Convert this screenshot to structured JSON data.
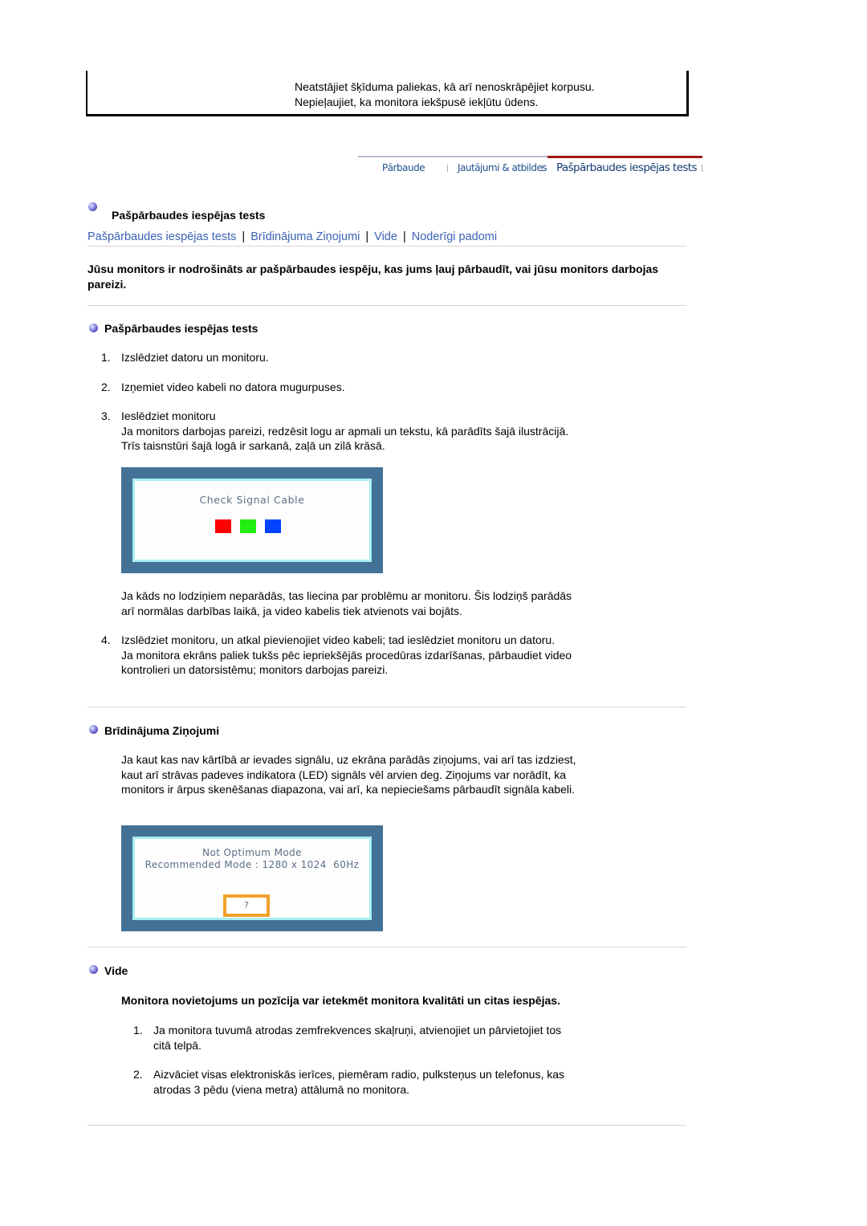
{
  "top_note": {
    "lines": [
      "Neatstājiet šķīduma paliekas, kā arī nenoskrāpējiet korpusu.",
      "Nepieļaujiet, ka monitora iekšpusē iekļūtu ūdens."
    ]
  },
  "tabs": [
    {
      "label": "Pārbaude",
      "active": false
    },
    {
      "label": "Jautājumi & atbildes",
      "active": false
    },
    {
      "label": "Pašpārbaudes iespējas tests",
      "active": true
    }
  ],
  "colors": {
    "link": "#3a62b5",
    "tab_active_line": "#a01818",
    "osd_frame": "#437296",
    "osd_highlight": "#a8eef2",
    "square_red": "#ff0000",
    "square_green": "#22ee11",
    "square_blue": "#0044ff",
    "question_border": "#f0a12a"
  },
  "page_title": "Pašpārbaudes iespējas tests",
  "nav_links": [
    "Pašpārbaudes iespējas tests",
    "Brīdinājuma Ziņojumi",
    "Vide",
    "Noderīgi padomi"
  ],
  "intro": "Jūsu monitors ir nodrošināts ar pašpārbaudes iespēju, kas jums ļauj pārbaudīt, vai jūsu monitors darbojas pareizi.",
  "self_test": {
    "heading": "Pašpārbaudes iespējas tests",
    "steps": [
      {
        "num": "1.",
        "text": "Izslēdziet datoru un monitoru."
      },
      {
        "num": "2.",
        "text": "Izņemiet video kabeli no datora mugurpuses."
      },
      {
        "num": "3.",
        "text": "Ieslēdziet monitoru",
        "detail": [
          "Ja monitors darbojas pareizi, redzēsit logu ar apmali un tekstu, kā parādīts šajā ilustrācijā.",
          "Trīs taisnstūri šajā logā ir sarkanā, zaļā un zilā krāsā."
        ]
      },
      {
        "num": "4.",
        "text": "Izslēdziet monitoru, un atkal pievienojiet video kabeli; tad ieslēdziet monitoru un datoru.",
        "detail": [
          "Ja monitora ekrāns paliek tukšs pēc iepriekšējās procedūras izdarīšanas, pārbaudiet video",
          "kontrolieri un datorsistēmu; monitors darbojas pareizi."
        ]
      }
    ],
    "osd_caption": "Check Signal Cable",
    "after_image": [
      "Ja kāds no lodziņiem neparādās, tas liecina par problēmu ar monitoru. Šis lodziņš parādās",
      "arī normālas darbības laikā, ja video kabelis tiek atvienots vai bojāts."
    ]
  },
  "warnings": {
    "heading": "Brīdinājuma Ziņojumi",
    "text": [
      "Ja kaut kas nav kārtībā ar ievades signālu, uz ekrāna parādās ziņojums, vai arī tas izdziest,",
      "kaut arī strāvas padeves indikatora (LED) signāls vēl arvien deg. Ziņojums var norādīt, ka",
      "monitors ir ārpus skenēšanas diapazona, vai arī, ka nepieciešams pārbaudīt signāla kabeli."
    ],
    "osd_line1": "Not Optimum Mode",
    "osd_line2": "Recommended Mode : 1280 x 1024  60Hz",
    "osd_button": "?"
  },
  "environment": {
    "heading": "Vide",
    "lead": "Monitora novietojums un pozīcija var ietekmēt monitora kvalitāti un citas iespējas.",
    "items": [
      {
        "num": "1.",
        "lines": [
          "Ja monitora tuvumā atrodas zemfrekvences skaļruņi, atvienojiet un pārvietojiet tos",
          "citā telpā."
        ]
      },
      {
        "num": "2.",
        "lines": [
          "Aizvāciet visas elektroniskās ierīces, piemēram radio, pulksteņus un telefonus, kas",
          "atrodas 3 pēdu (viena metra) attālumā no monitora."
        ]
      }
    ]
  }
}
